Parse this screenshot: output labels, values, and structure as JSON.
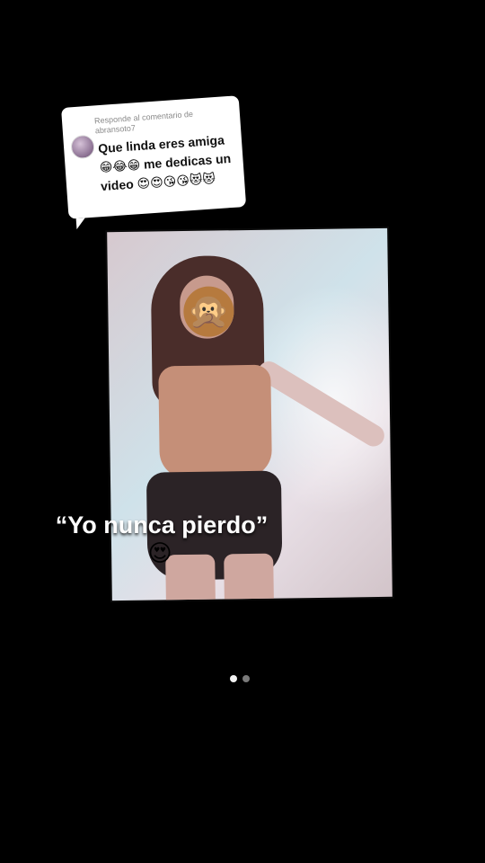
{
  "reply": {
    "header": "Responde al comentario de abransoto7",
    "text": "Que linda eres amiga 😁😂😁 me dedicas un video 😍😍😘😘😻😻"
  },
  "media": {
    "face_cover_emoji": "🙊"
  },
  "caption": {
    "text": "“Yo nunca pierdo”",
    "emoji": "😍"
  },
  "pagination": {
    "current": 1,
    "total": 2
  },
  "icons": {
    "avatar": "commenter-avatar",
    "pager": "page-dot"
  },
  "colors": {
    "background": "#000000",
    "bubble": "#ffffff",
    "caption": "#ffffff",
    "dot_active": "#f2f2f2",
    "dot_inactive": "#7a7a7a"
  }
}
